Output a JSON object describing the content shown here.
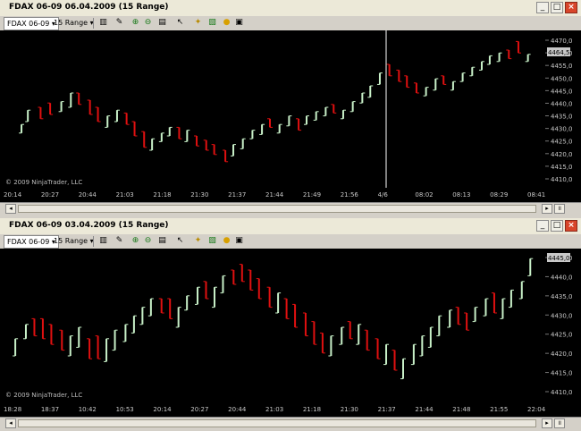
{
  "top": {
    "title": "FDAX 06-09  06.04.2009 (15 Range)",
    "instrument": "FDAX 06-09",
    "bar_type": "15 Range",
    "copyright": "© 2009 NinjaTrader, LLC",
    "price_labels": [
      "4470,0",
      "4460,0",
      "4455,0",
      "4450,0",
      "4445,0",
      "4440,0",
      "4435,0",
      "4430,0",
      "4425,0",
      "4420,0",
      "4415,0",
      "4410,0"
    ],
    "last_price": "4464,5",
    "time_labels": [
      "20:14",
      "20:27",
      "20:44",
      "21:03",
      "21:18",
      "21:30",
      "21:37",
      "21:44",
      "21:49",
      "21:56",
      "4/6",
      "08:02",
      "08:13",
      "08:29",
      "08:41"
    ],
    "crosshair_label": "4/6"
  },
  "bottom": {
    "title": "FDAX 06-09  03.04.2009 (15 Range)",
    "instrument": "FDAX 06-09",
    "bar_type": "15 Range",
    "copyright": "© 2009 NinjaTrader, LLC",
    "price_labels": [
      "4445,0",
      "4440,0",
      "4435,0",
      "4430,0",
      "4425,0",
      "4420,0",
      "4415,0",
      "4410,0"
    ],
    "last_price": "4445,0",
    "time_labels": [
      "18:28",
      "18:37",
      "10:42",
      "10:53",
      "20:14",
      "20:27",
      "20:44",
      "21:03",
      "21:18",
      "21:30",
      "21:37",
      "21:44",
      "21:48",
      "21:55",
      "22:04"
    ]
  },
  "colors": {
    "up": "#c8f0c8",
    "down": "#e01010",
    "bg": "#000000",
    "text": "#c8c8c8"
  },
  "icons": [
    "dropdown-icon",
    "bars-icon",
    "pencil-icon",
    "zoom-in-icon",
    "zoom-out-icon",
    "properties-icon",
    "cursor-icon",
    "strategy-icon",
    "chart-trader-icon",
    "indicators-icon",
    "data-box-icon",
    "alert-icon"
  ]
}
